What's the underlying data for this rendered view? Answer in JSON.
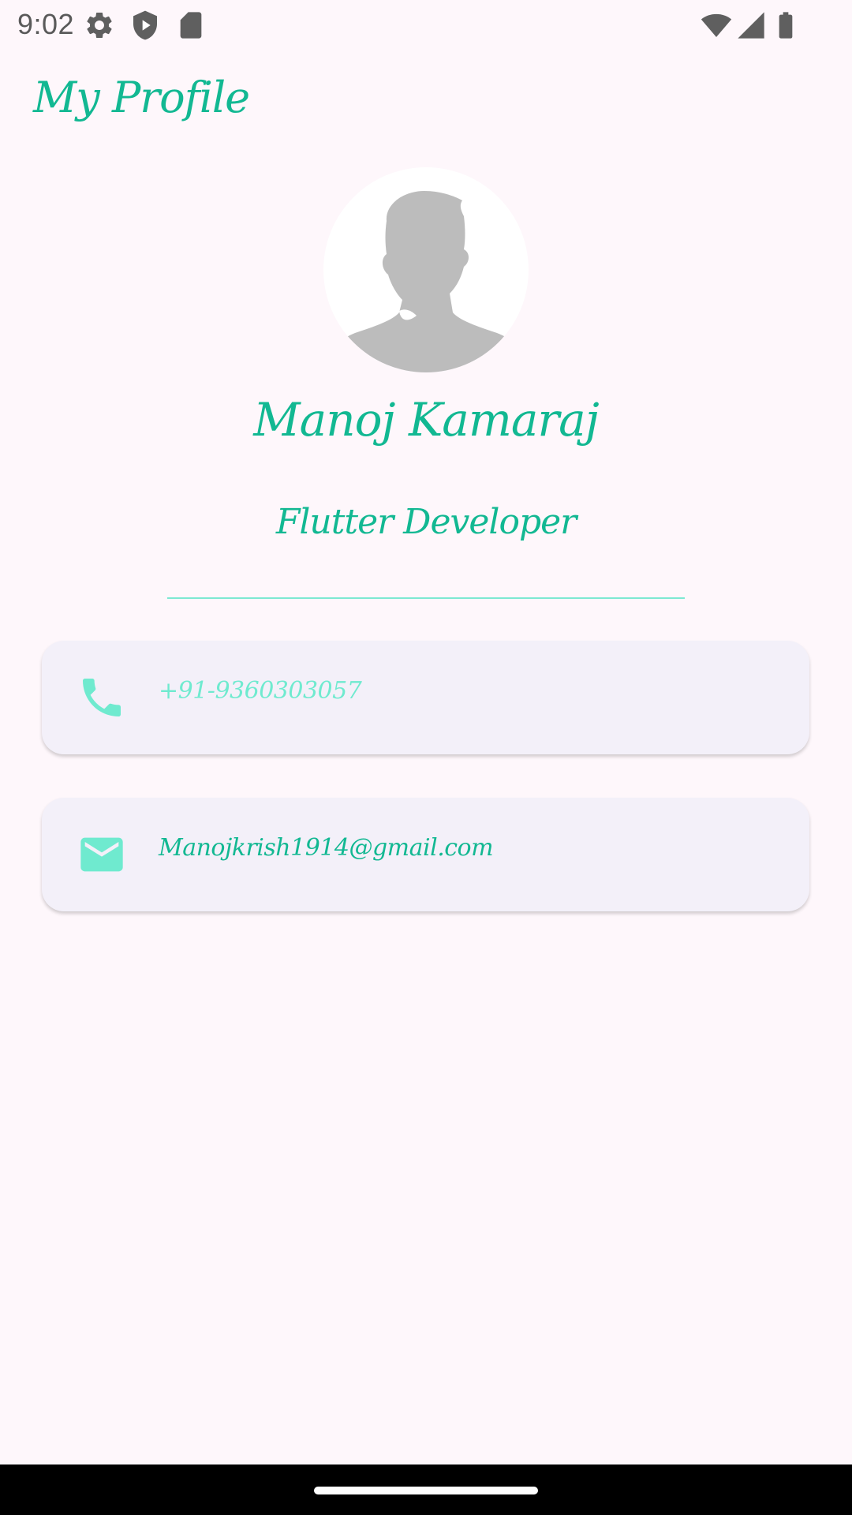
{
  "status_bar": {
    "time": "9:02",
    "left_icons": [
      "gear-icon",
      "shield-play-icon",
      "sd-card-icon"
    ],
    "right_icons": [
      "wifi-icon",
      "cell-signal-icon",
      "battery-icon"
    ]
  },
  "app_bar": {
    "title": "My Profile"
  },
  "profile": {
    "avatar_icon": "person-silhouette-icon",
    "name": "Manoj Kamaraj",
    "role": "Flutter Developer"
  },
  "contacts": {
    "phone": {
      "icon": "phone-icon",
      "value": "+91-9360303057"
    },
    "email": {
      "icon": "mail-icon",
      "value": "Manojkrish1914@gmail.com"
    }
  },
  "colors": {
    "accent": "#12b892",
    "accent_light": "#6feacf",
    "background": "#fef7fb",
    "card_background": "#f3f0f9"
  }
}
